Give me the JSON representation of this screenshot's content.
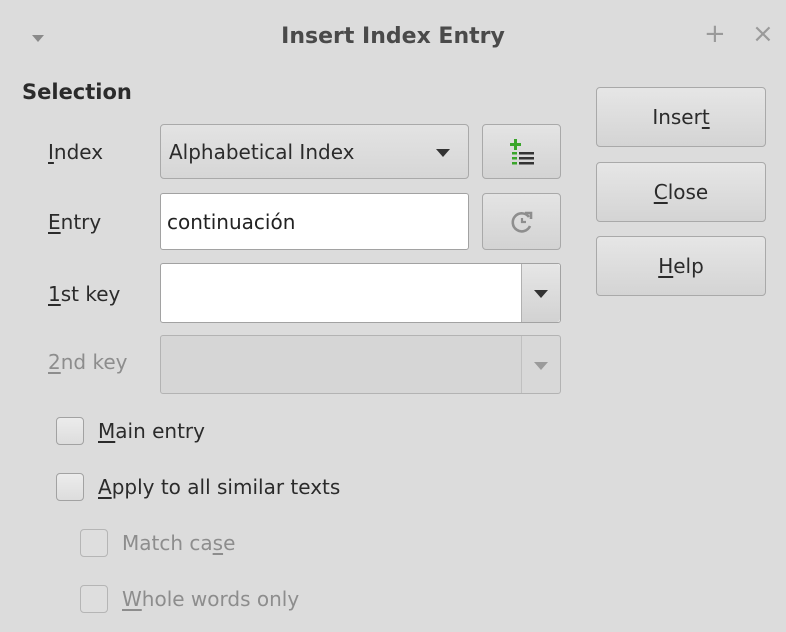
{
  "dialog": {
    "title": "Insert Index Entry",
    "pin_glyph": "+",
    "close_glyph": "×"
  },
  "selection": {
    "heading": "Selection",
    "index": {
      "label_u": "I",
      "label_rest": "ndex",
      "value": "Alphabetical Index"
    },
    "entry": {
      "label_u": "E",
      "label_rest": "ntry",
      "value": "continuación"
    },
    "key1": {
      "label_u": "1",
      "label_rest": "st key",
      "value": ""
    },
    "key2": {
      "label_u": "2",
      "label_rest": "nd key",
      "value": ""
    },
    "main_entry": {
      "label_u": "M",
      "label_rest": "ain entry",
      "checked": false
    },
    "apply_all": {
      "label_u": "A",
      "label_rest": "pply to all similar texts",
      "checked": false
    },
    "match_case": {
      "label_pre": "Match ca",
      "label_u": "s",
      "label_rest": "e",
      "checked": false
    },
    "whole_words": {
      "label_u": "W",
      "label_rest": "hole words only",
      "checked": false
    }
  },
  "buttons": {
    "insert": {
      "pre": "Inser",
      "u": "t",
      "rest": ""
    },
    "close": {
      "pre": "",
      "u": "C",
      "rest": "lose"
    },
    "help": {
      "pre": "",
      "u": "H",
      "rest": "elp"
    }
  },
  "icons": {
    "new_index": "new-user-defined-index-icon",
    "refresh": "refresh-icon"
  },
  "colors": {
    "background": "#dcdcdc",
    "green_accent": "#3aa52a"
  }
}
